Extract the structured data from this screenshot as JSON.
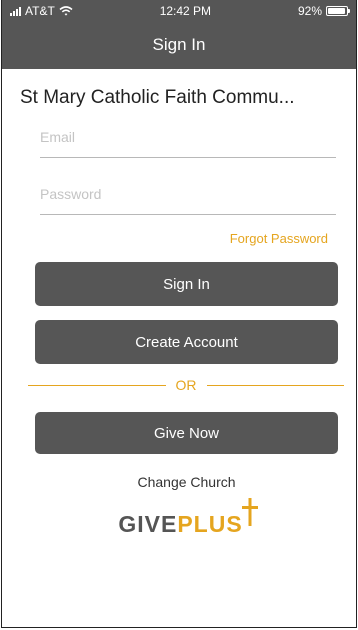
{
  "status_bar": {
    "carrier": "AT&T",
    "time": "12:42 PM",
    "battery_percent": "92%",
    "battery_level": 0.92
  },
  "nav": {
    "title": "Sign In"
  },
  "church": {
    "name": "St Mary Catholic Faith Commu..."
  },
  "form": {
    "email_placeholder": "Email",
    "password_placeholder": "Password",
    "forgot_label": "Forgot Password"
  },
  "buttons": {
    "sign_in": "Sign In",
    "create_account": "Create Account",
    "divider_label": "OR",
    "give_now": "Give Now"
  },
  "footer": {
    "change_church": "Change Church",
    "logo_give": "GIVE",
    "logo_plus": "PLUS"
  },
  "colors": {
    "header_bg": "#565656",
    "accent": "#e5a51f",
    "button_bg": "#565656"
  },
  "icons": [
    "signal-icon",
    "wifi-icon",
    "battery-icon",
    "cross-icon"
  ]
}
